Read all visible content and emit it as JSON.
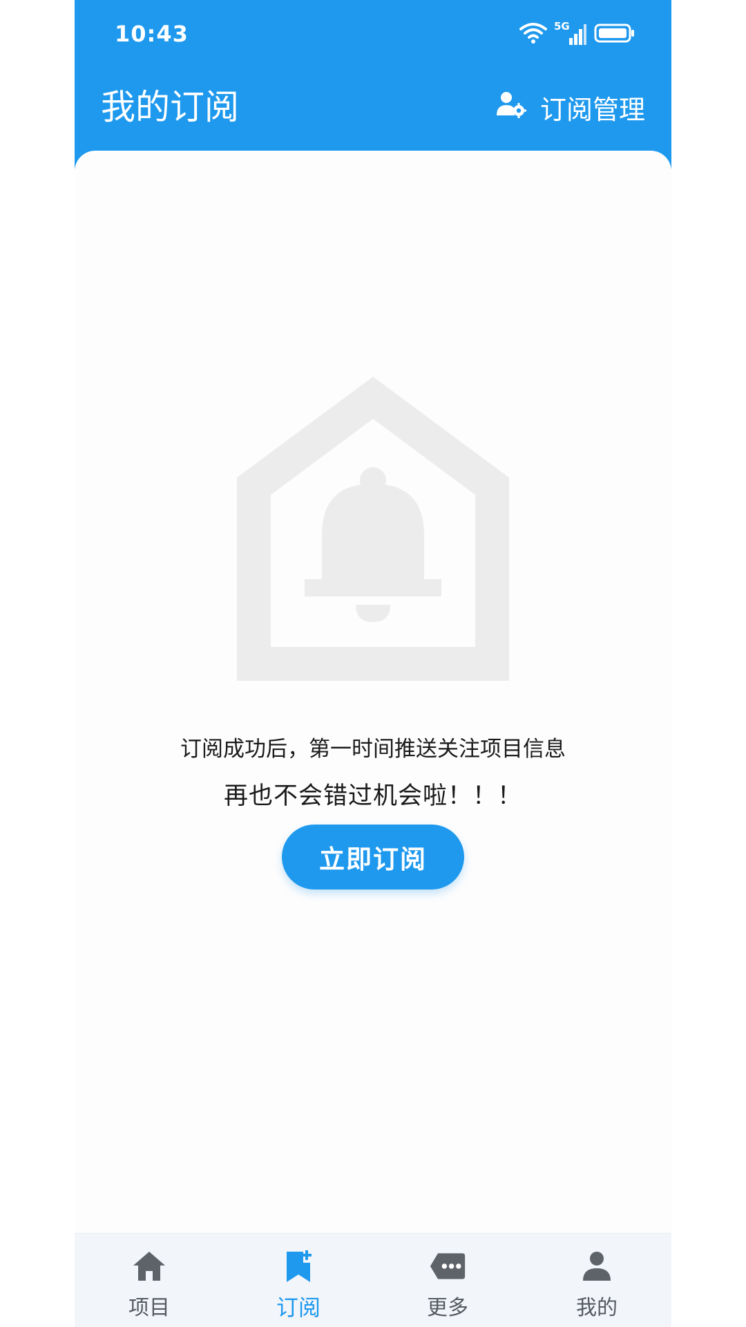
{
  "status_bar": {
    "time": "10:43",
    "network": "5G"
  },
  "header": {
    "title": "我的订阅",
    "manage_label": "订阅管理",
    "manage_icon": "user-settings-icon"
  },
  "empty_state": {
    "illustration": "house-bell-icon",
    "line1": "订阅成功后，第一时间推送关注项目信息",
    "line2": "再也不会错过机会啦！！！",
    "button_label": "立即订阅"
  },
  "bottom_nav": {
    "items": [
      {
        "label": "项目",
        "icon": "home-icon",
        "active": false
      },
      {
        "label": "订阅",
        "icon": "bookmark-plus-icon",
        "active": true
      },
      {
        "label": "更多",
        "icon": "more-tag-icon",
        "active": false
      },
      {
        "label": "我的",
        "icon": "person-icon",
        "active": false
      }
    ]
  },
  "colors": {
    "primary": "#1e99ee",
    "illustration_gray": "#ececec",
    "nav_inactive": "#555a60",
    "nav_background": "#f2f5fa"
  }
}
